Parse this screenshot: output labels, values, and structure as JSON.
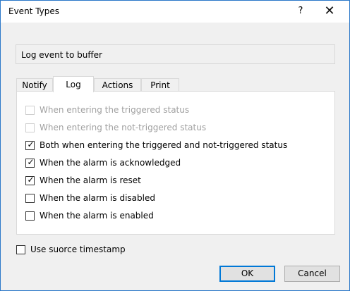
{
  "window": {
    "title": "Event Types",
    "help_label": "?",
    "close_label": "✕"
  },
  "header": {
    "text": "Log event to buffer"
  },
  "tabs": [
    {
      "label": "Notify",
      "active": false
    },
    {
      "label": "Log",
      "active": true
    },
    {
      "label": "Actions",
      "active": false
    },
    {
      "label": "Print",
      "active": false
    }
  ],
  "options": [
    {
      "label": "When entering the triggered status",
      "checked": false,
      "enabled": false
    },
    {
      "label": "When entering the not-triggered status",
      "checked": false,
      "enabled": false
    },
    {
      "label": "Both when entering the triggered and not-triggered status",
      "checked": true,
      "enabled": true
    },
    {
      "label": "When the alarm is acknowledged",
      "checked": true,
      "enabled": true
    },
    {
      "label": "When the alarm is reset",
      "checked": true,
      "enabled": true
    },
    {
      "label": "When the alarm is disabled",
      "checked": false,
      "enabled": true
    },
    {
      "label": "When the alarm is enabled",
      "checked": false,
      "enabled": true
    }
  ],
  "timestamp": {
    "label": "Use suorce timestamp",
    "checked": false
  },
  "buttons": {
    "ok": "OK",
    "cancel": "Cancel"
  },
  "check_glyph": "✓"
}
